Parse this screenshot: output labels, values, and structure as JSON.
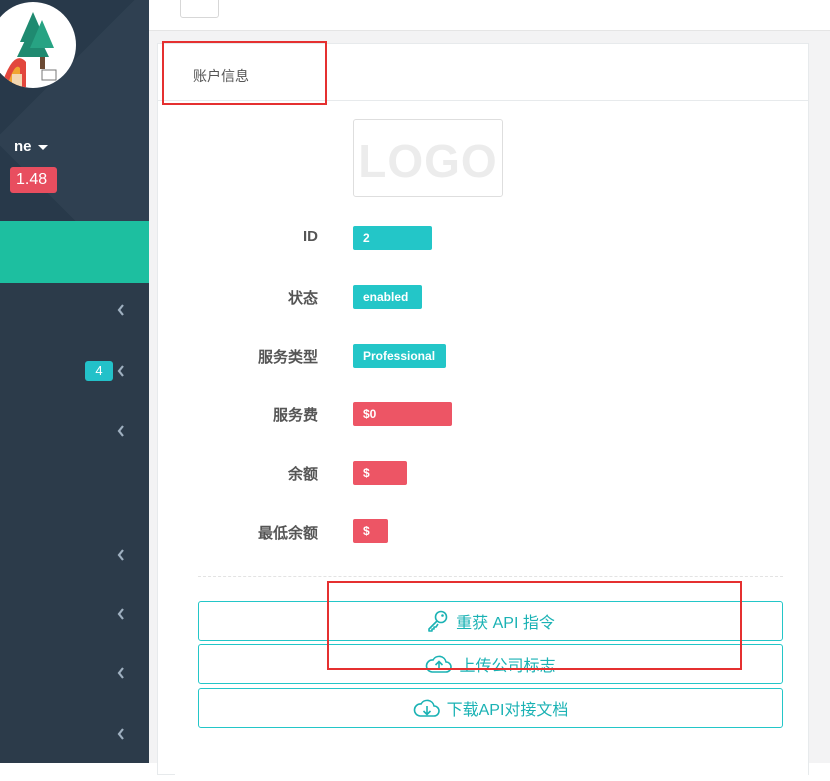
{
  "sidebar": {
    "username": "ne",
    "balance_badge": "1.48",
    "nav_count_badge": "4"
  },
  "card": {
    "title": "账户信息",
    "logo_text": "LOGO",
    "fields": [
      {
        "label": "ID",
        "value": "2"
      },
      {
        "label": "状态",
        "value": "enabled"
      },
      {
        "label": "服务类型",
        "value": "Professional"
      },
      {
        "label": "服务费",
        "value": "$0"
      },
      {
        "label": "余额",
        "value": "$"
      },
      {
        "label": "最低余额",
        "value": "$"
      }
    ],
    "buttons": {
      "regen_api": "重获 API 指令",
      "upload_logo": "上传公司标志",
      "download_doc": "下载API对接文档"
    }
  },
  "colors": {
    "sidebar_bg": "#2c3b4a",
    "accent_green": "#1dbfa0",
    "teal": "#23c6c8",
    "red": "#ed5565",
    "annotation_red": "#e53030"
  },
  "icons": [
    "chevron-left-icon",
    "key-icon",
    "cloud-upload-icon",
    "cloud-download-icon",
    "caret-down-icon"
  ]
}
